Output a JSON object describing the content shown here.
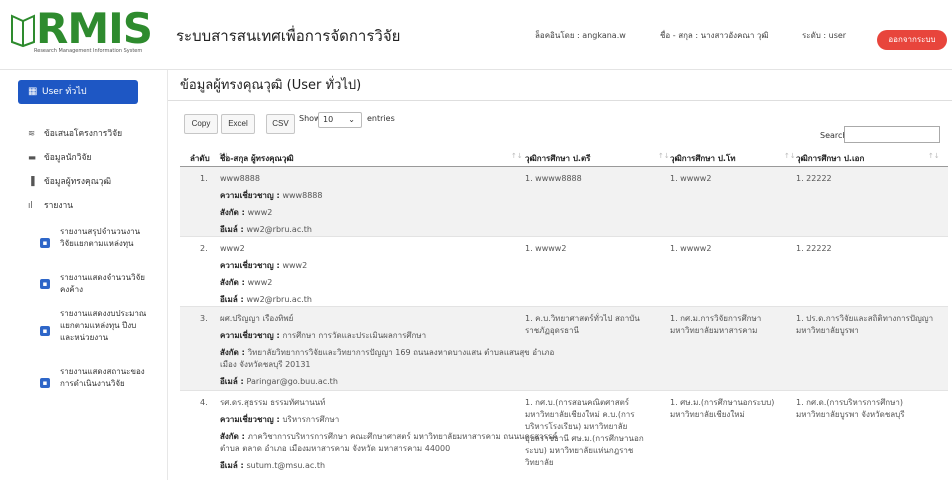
{
  "header": {
    "logo_text": "RMIS",
    "logo_tagline": "Research Management Information System",
    "system_title": "ระบบสารสนเทศเพื่อการจัดการวิจัย",
    "login_label": "ล็อคอินโดย : angkana.w",
    "name_label": "ชื่อ - สกุล : นางสาวอังคณา วุฒิ",
    "role_label": "ระดับ : user",
    "logout_label": "ออกจากระบบ",
    "logout_color": "#e8453c"
  },
  "sidebar": {
    "active_item": "User ทั่วไป",
    "active_color": "#1e57c4",
    "items": [
      {
        "label": "ข้อเสนอโครงการวิจัย",
        "icon": "layers-icon"
      },
      {
        "label": "ข้อมูลนักวิจัย",
        "icon": "folder-icon"
      },
      {
        "label": "ข้อมูลผู้ทรงคุณวุฒิ",
        "icon": "columns-icon"
      },
      {
        "label": "รายงาน",
        "icon": "bar-chart-icon"
      }
    ],
    "sub_items": [
      {
        "label": "รายงานสรุปจำนวนงานวิจัยแยกตามแหล่งทุน"
      },
      {
        "label": "รายงานแสดงจำนวนวิจัยคงค้าง"
      },
      {
        "label": "รายงานแสดงงบประมาณแยกตามแหล่งทุน ปีงบ และหน่วยงาน"
      },
      {
        "label": "รายงานแสดงสถานะของการดำเนินงานวิจัย"
      }
    ]
  },
  "main": {
    "page_title": "ข้อมูลผู้ทรงคุณวุฒิ (User ทั่วไป)",
    "buttons": {
      "copy": "Copy",
      "excel": "Excel",
      "csv": "CSV"
    },
    "show_label": "Show",
    "entries_value": "10",
    "entries_label": "entries",
    "search_label": "Search:",
    "search_value": "",
    "columns": [
      "ลำดับ",
      "ชื่อ-สกุล ผู้ทรงคุณวุฒิ",
      "วุฒิการศึกษา ป.ตรี",
      "วุฒิการศึกษา ป.โท",
      "วุฒิการศึกษา ป.เอก"
    ],
    "labels": {
      "expertise": "ความเชี่ยวชาญ : ",
      "affiliation": "สังกัด : ",
      "email": "อีเมล์ : "
    },
    "rows": [
      {
        "no": "1.",
        "name": "www8888",
        "expertise": "www8888",
        "affiliation": "www2",
        "email": "ww2@rbru.ac.th",
        "ba": "1. wwww8888",
        "ma": "1. wwww2",
        "phd": "1. 22222"
      },
      {
        "no": "2.",
        "name": "www2",
        "expertise": "www2",
        "affiliation": "www2",
        "email": "ww2@rbru.ac.th",
        "ba": "1. wwww2",
        "ma": "1. wwww2",
        "phd": "1. 22222"
      },
      {
        "no": "3.",
        "name": "ผศ.ปริญญา เรืองทิพย์",
        "expertise": "การศึกษา การวัดและประเมินผลการศึกษา",
        "affiliation": "วิทยาลัยวิทยาการวิจัยและวิทยาการปัญญา 169 ถนนลงหาดบางแสน ตำบลแสนสุข อำเภอเมือง จังหวัดชลบุรี 20131",
        "email": "Paringar@go.buu.ac.th",
        "ba": "1. ค.บ.วิทยาศาสตร์ทั่วไป สถาบันราชภัฏอุดรธานี",
        "ma": "1. กศ.ม.การวิจัยการศึกษา มหาวิทยาลัยมหาสารคาม",
        "phd": "1. ปร.ด.การวิจัยและสถิติทางการปัญญา มหาวิทยาลัยบูรพา"
      },
      {
        "no": "4.",
        "name": "รศ.ดร.สุธรรม ธรรมทัศนานนท์",
        "expertise": "บริหารการศึกษา",
        "affiliation": "ภาควิชาการบริหารการศึกษา คณะศึกษาศาสตร์ มหาวิทยาลัยมหาสารคาม ถนนนครสวรรค์ ตำบล ตลาด อำเภอ เมืองมหาสารคาม จังหวัด มหาสารคาม 44000",
        "email": "sutum.t@msu.ac.th",
        "ba": "1. กศ.บ.(การสอนคณิตศาสตร์ มหาวิทยาลัยเชียงใหม่ ค.บ.(การบริหารโรงเรียน) มหาวิทยาลัยอุบลราชธานี ศษ.ม.(การศึกษานอกระบบ) มหาวิทยาลัยแห่นกฎราชวิทยาลัย",
        "ma": "1. ศษ.ม.(การศึกษานอกระบบ) มหาวิทยาลัยเชียงใหม่",
        "phd": "1. กศ.ด.(การบริหารการศึกษา) มหาวิทยาลัยบูรพา จังหวัดชลบุรี"
      }
    ]
  }
}
